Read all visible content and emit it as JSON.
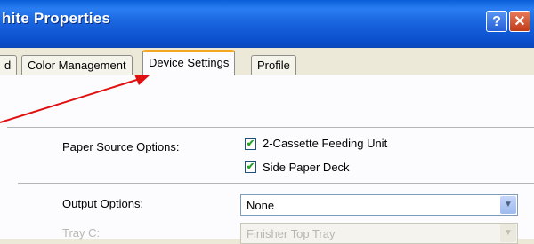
{
  "window": {
    "title": "hite Properties",
    "help_label": "?",
    "close_label": "✕"
  },
  "tabs": [
    {
      "label": "d"
    },
    {
      "label": "Color Management"
    },
    {
      "label": "Device Settings",
      "active": true
    },
    {
      "label": "Profile"
    }
  ],
  "settings": {
    "paper_source": {
      "label": "Paper Source Options:",
      "options": [
        {
          "label": "2-Cassette Feeding Unit",
          "checked": true
        },
        {
          "label": "Side Paper Deck",
          "checked": true
        }
      ]
    },
    "output": {
      "label": "Output Options:",
      "value": "None"
    },
    "tray": {
      "label": "Tray C:",
      "value": "Finisher Top Tray",
      "disabled": true
    }
  },
  "annotation": {
    "arrow_color": "#e01010"
  },
  "colors": {
    "titlebar": "#0b4fcc",
    "active_tab_accent": "#f5a623",
    "check_mark": "#21a121"
  }
}
